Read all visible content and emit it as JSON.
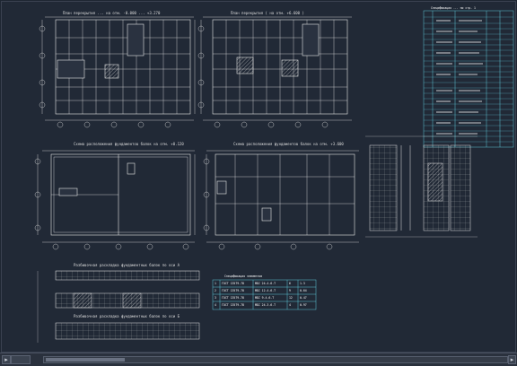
{
  "app": {
    "title": "",
    "model_tab_label": "",
    "status_left_icon": "menu-arrow-icon",
    "scroll_right_icon": "scroll-right-icon"
  },
  "colors": {
    "background": "#212936",
    "lines": "#e0e0e0",
    "cyan_table": "#5fc8d6",
    "hatch": "#d0d0d0"
  },
  "drawing": {
    "plan1_title": "План перекрытия ... на отм. -0.000 ... +3.270",
    "plan2_title": "План перекрытия ( на отм. +6.600 )",
    "plan3_title": "Схема расположения фундаментов балок на отм. +0.120",
    "plan4_title": "Схема расположения фундаментов балок на отм. +3.600",
    "detail1_title": "Разбивочная раскладка фундаментных балок по оси А",
    "detail2_title": "Разбивочная раскладка фундаментных балок по оси Б",
    "table_title": "Спецификация элементов",
    "spec_title": "Спецификация ... по стр. 1",
    "spec_headers": [
      "Поз.",
      "Обозначение",
      "Наименование",
      "Кол.",
      "Масса"
    ],
    "spec_rows": [
      [
        "1",
        "ГОСТ 13579-78",
        "ФБС 24.4.6-Т",
        "6",
        "1.3"
      ],
      [
        "2",
        "ГОСТ 13579-78",
        "ФБС 12.4.6-Т",
        "9",
        "0.64"
      ],
      [
        "3",
        "ГОСТ 13579-78",
        "ФБС 9.4.6-Т",
        "12",
        "0.47"
      ],
      [
        "4",
        "ГОСТ 13579-78",
        "ФБС 24.3.6-Т",
        "4",
        "0.97"
      ]
    ]
  }
}
